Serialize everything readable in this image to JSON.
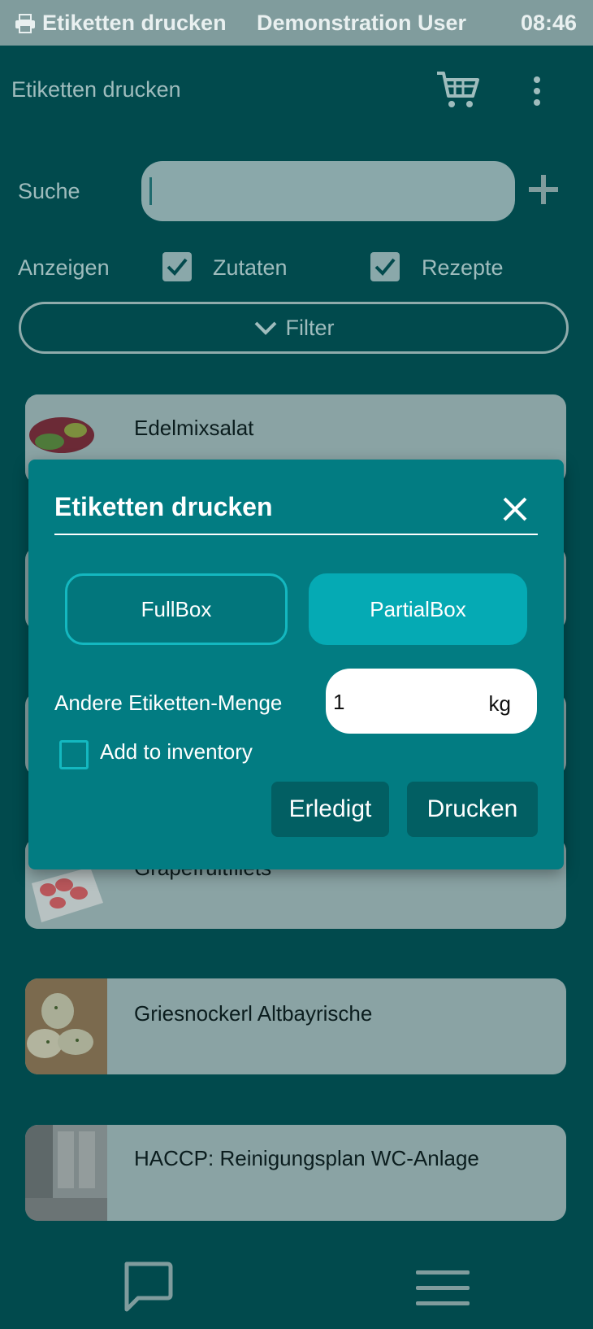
{
  "status_bar": {
    "icon": "printer-icon",
    "title": "Etiketten drucken",
    "user": "Demonstration User",
    "time": "08:46"
  },
  "app_bar": {
    "title": "Etiketten drucken",
    "cart_icon": "cart-icon",
    "more_icon": "more-vertical-icon"
  },
  "search": {
    "label": "Suche",
    "value": "",
    "add_icon": "plus-icon"
  },
  "show": {
    "label": "Anzeigen",
    "options": [
      {
        "label": "Zutaten",
        "checked": true
      },
      {
        "label": "Rezepte",
        "checked": true
      }
    ]
  },
  "filter": {
    "label": "Filter",
    "icon": "chevron-down-icon"
  },
  "list": {
    "items": [
      {
        "name": "Edelmixsalat"
      },
      {
        "name": "Grapefruitfilets"
      },
      {
        "name": "Griesnockerl Altbayrische"
      },
      {
        "name": "HACCP: Reinigungsplan WC-Anlage"
      }
    ]
  },
  "dialog": {
    "title": "Etiketten drucken",
    "close_icon": "close-icon",
    "segments": {
      "full": "FullBox",
      "partial": "PartialBox",
      "selected": "PartialBox"
    },
    "quantity_label": "Andere Etiketten-Menge",
    "quantity_value": "1",
    "quantity_unit": "kg",
    "add_to_inventory_label": "Add to inventory",
    "add_to_inventory_checked": false,
    "done_label": "Erledigt",
    "print_label": "Drucken"
  },
  "bottom_bar": {
    "chat_icon": "chat-icon",
    "menu_icon": "menu-icon"
  },
  "colors": {
    "background": "#014a4d",
    "dialog": "#027c82",
    "accent": "#05aab4",
    "list_item": "#8aa3a4"
  }
}
